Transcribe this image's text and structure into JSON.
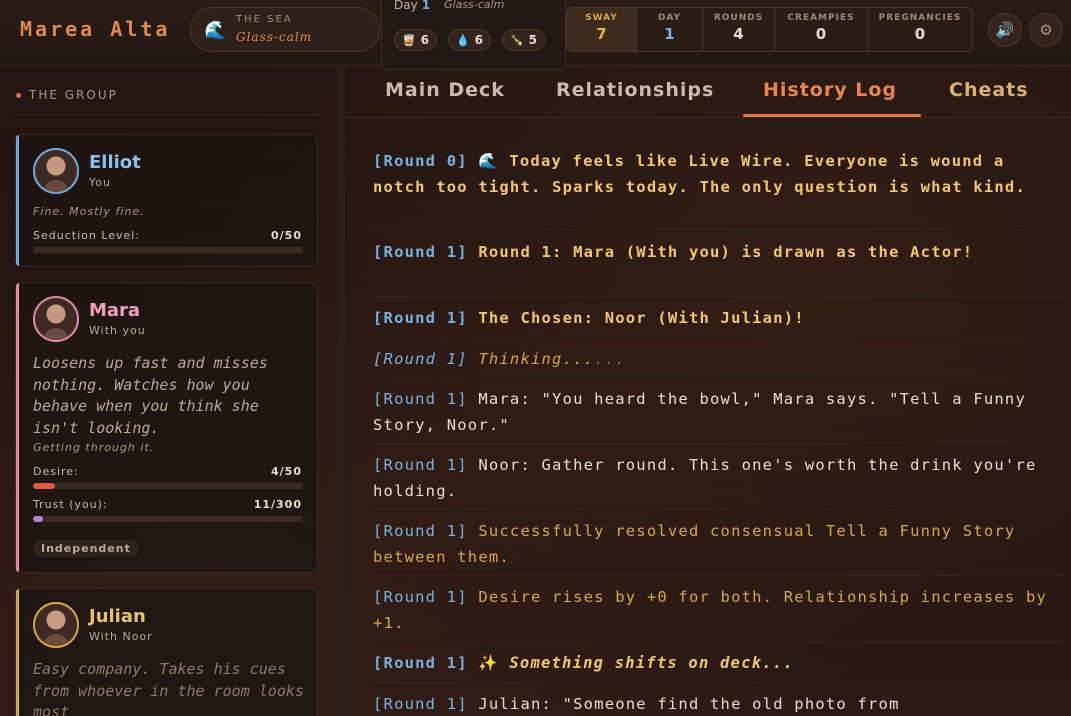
{
  "brand": "Marea Alta",
  "sea": {
    "label": "THE SEA",
    "value": "Glass-calm",
    "icon": "wave-icon"
  },
  "day_popup": {
    "label": "Day",
    "day": "1",
    "value": "Glass-calm",
    "pills": [
      {
        "icon": "drink-icon",
        "value": "6"
      },
      {
        "icon": "drop-icon",
        "value": "6"
      },
      {
        "icon": "bottle-icon",
        "value": "5"
      }
    ]
  },
  "stats": [
    {
      "label": "SWAY",
      "value": "7"
    },
    {
      "label": "DAY",
      "value": "1"
    },
    {
      "label": "ROUNDS",
      "value": "4"
    },
    {
      "label": "CREAMPIES",
      "value": "0"
    },
    {
      "label": "PREGNANCIES",
      "value": "0"
    }
  ],
  "buttons": {
    "sound_icon": "speaker-icon",
    "settings_icon": "gear-icon"
  },
  "sidebar": {
    "title": "THE GROUP",
    "cards": [
      {
        "name": "Elliot",
        "sub": "You",
        "mood": "Fine. Mostly fine.",
        "meter1_label": "Seduction Level:",
        "meter1_value": "0/50",
        "meter1_fraction": 0,
        "accent": "#6fa8dc"
      },
      {
        "name": "Mara",
        "sub": "With you",
        "desc": "Loosens up fast and misses nothing. Watches how you behave when you think she isn't looking.",
        "mood": "Getting through it.",
        "meter1_label": "Desire:",
        "meter1_value": "4/50",
        "meter1_fraction": 0.08,
        "meter2_label": "Trust (you):",
        "meter2_value": "11/300",
        "meter2_fraction": 0.037,
        "tag": "Independent",
        "accent": "#e08aa8"
      },
      {
        "name": "Julian",
        "sub": "With Noor",
        "desc": "Easy company. Takes his cues from whoever in the room looks most",
        "accent": "#d4a64a"
      }
    ]
  },
  "tabs": [
    "Main Deck",
    "Relationships",
    "History Log",
    "Cheats"
  ],
  "active_tab": "History Log",
  "log": [
    {
      "round": "[Round 0]",
      "text": " 🌊 Today feels like Live Wire. Everyone is wound a notch too tight. Sparks today. The only question is what kind."
    },
    {
      "round": "[Round 1]",
      "text": " Round 1: Mara (With you) is drawn as the Actor!"
    },
    {
      "round": "[Round 1]",
      "text": " The Chosen: Noor (With Julian)!"
    },
    {
      "round": "[Round 1]",
      "text": " Thinking...",
      "dots": "..."
    },
    {
      "round": "[Round 1]",
      "text": " Mara: \"You heard the bowl,\" Mara says. \"Tell a Funny Story, Noor.\""
    },
    {
      "round": "[Round 1]",
      "text": " Noor: Gather round. This one's worth the drink you're holding."
    },
    {
      "round": "[Round 1]",
      "text": " Successfully resolved consensual Tell a Funny Story between them."
    },
    {
      "round": "[Round 1]",
      "text": " Desire rises by +0 for both. Relationship increases by +1."
    },
    {
      "round": "[Round 1]",
      "icon": " ✨ ",
      "text": "Something shifts on deck..."
    },
    {
      "round": "[Round 1]",
      "text": " Julian: \"Someone find the old photo from"
    }
  ]
}
